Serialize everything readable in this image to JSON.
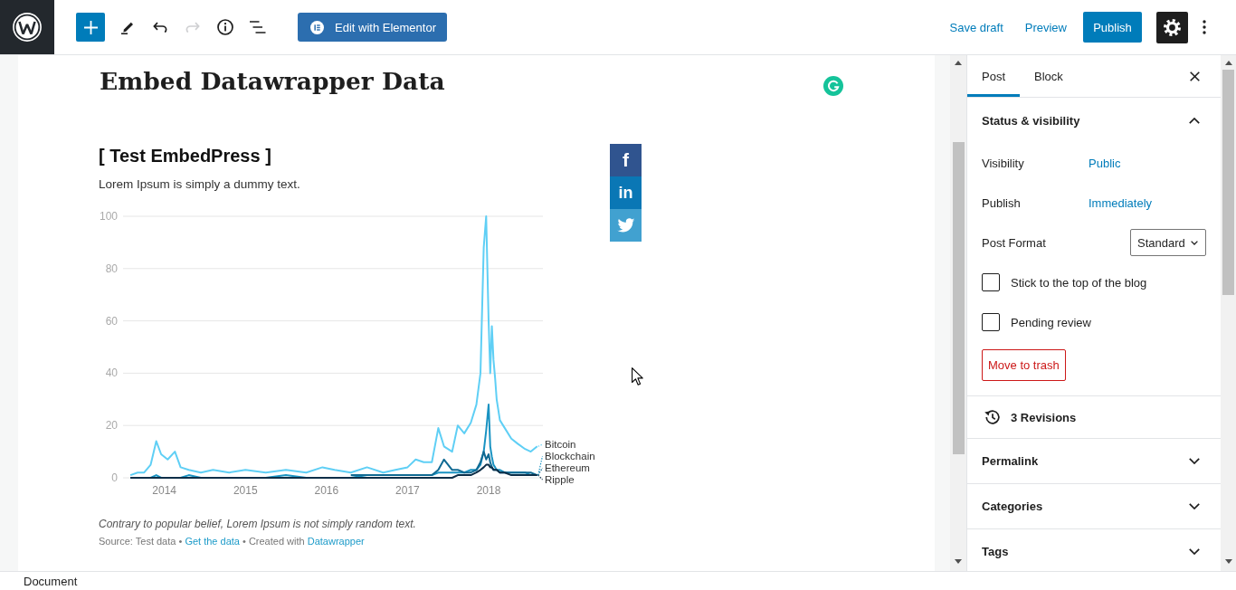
{
  "header": {
    "tools": [
      {
        "kind": "edit",
        "disabled": false
      },
      {
        "kind": "undo",
        "disabled": false
      },
      {
        "kind": "redo",
        "disabled": true
      },
      {
        "kind": "details",
        "disabled": false
      },
      {
        "kind": "outline",
        "disabled": false
      }
    ],
    "elementor_button": "Edit with Elementor",
    "save_draft": "Save draft",
    "preview": "Preview",
    "publish": "Publish",
    "settings_pressed": true
  },
  "editor": {
    "title": "Embed Datawrapper Data",
    "embed": {
      "title": "[ Test EmbedPress ]",
      "description": "Lorem Ipsum is simply a dummy text.",
      "chart_data": {
        "type": "line",
        "x": [
          2013.58,
          2013.67,
          2013.75,
          2013.83,
          2013.9,
          2013.96,
          2014.04,
          2014.13,
          2014.2,
          2014.3,
          2014.45,
          2014.6,
          2014.8,
          2015.0,
          2015.25,
          2015.5,
          2015.75,
          2015.95,
          2016.1,
          2016.3,
          2016.5,
          2016.7,
          2016.85,
          2017.0,
          2017.1,
          2017.2,
          2017.3,
          2017.38,
          2017.45,
          2017.55,
          2017.62,
          2017.7,
          2017.78,
          2017.85,
          2017.9,
          2017.94,
          2017.97,
          2018.0,
          2018.02,
          2018.04,
          2018.06,
          2018.08,
          2018.1,
          2018.14,
          2018.2,
          2018.28,
          2018.36,
          2018.45,
          2018.52,
          2018.6
        ],
        "series": [
          {
            "name": "Bitcoin",
            "color": "#5fcff5",
            "values": [
              1,
              2,
              2,
              5,
              14,
              9,
              7,
              10,
              4,
              3,
              2,
              3,
              2,
              3,
              2,
              3,
              2,
              4,
              3,
              2,
              4,
              2,
              3,
              4,
              7,
              6,
              6,
              19,
              12,
              10,
              20,
              17,
              21,
              28,
              40,
              88,
              100,
              60,
              40,
              58,
              45,
              38,
              30,
              22,
              19,
              15,
              13,
              11,
              10,
              12
            ]
          },
          {
            "name": "Blockchain",
            "color": "#1a93c2",
            "values": [
              0,
              0,
              0,
              0,
              1,
              0,
              0,
              0,
              0,
              1,
              0,
              0,
              0,
              0,
              0,
              1,
              0,
              0,
              0,
              0,
              1,
              1,
              1,
              1,
              1,
              1,
              1,
              2,
              2,
              2,
              2,
              2,
              3,
              3,
              5,
              10,
              18,
              28,
              12,
              8,
              5,
              4,
              3,
              3,
              2,
              2,
              2,
              2,
              1,
              1
            ]
          },
          {
            "name": "Ethereum",
            "color": "#106a93",
            "values": [
              null,
              null,
              null,
              null,
              null,
              null,
              null,
              null,
              null,
              null,
              null,
              null,
              null,
              null,
              null,
              null,
              null,
              null,
              null,
              1,
              1,
              1,
              1,
              1,
              1,
              1,
              1,
              3,
              7,
              3,
              3,
              2,
              2,
              3,
              6,
              10,
              7,
              9,
              6,
              4,
              3,
              3,
              3,
              2,
              2,
              2,
              2,
              2,
              2,
              1
            ]
          },
          {
            "name": "Ripple",
            "color": "#0c2e48",
            "values": [
              0,
              0,
              0,
              0,
              0,
              0,
              0,
              0,
              0,
              0,
              0,
              0,
              0,
              0,
              0,
              0,
              0,
              0,
              0,
              0,
              0,
              0,
              0,
              0,
              0,
              0,
              0,
              0,
              0,
              0,
              1,
              1,
              1,
              2,
              3,
              4,
              5,
              5,
              4,
              4,
              3,
              3,
              3,
              2,
              2,
              1,
              1,
              1,
              1,
              1
            ]
          }
        ],
        "xlim": [
          2013.49,
          2018.67
        ],
        "ylim": [
          0,
          100
        ],
        "xticks": [
          2014,
          2015,
          2016,
          2017,
          2018
        ],
        "yticks": [
          0,
          20,
          40,
          60,
          80,
          100
        ],
        "grid": true,
        "legend": "right"
      },
      "notes": "Contrary to popular belief, Lorem Ipsum is not simply random text.",
      "source": [
        {
          "kind": "text",
          "text": "Source: Test data • "
        },
        {
          "kind": "link",
          "text": "Get the data"
        },
        {
          "kind": "text",
          "text": " • Created with "
        },
        {
          "kind": "link",
          "text": "Datawrapper"
        }
      ],
      "share_buttons": [
        {
          "kind": "facebook",
          "glyph": "f"
        },
        {
          "kind": "linkedin",
          "glyph": "in"
        },
        {
          "kind": "twitter"
        }
      ]
    }
  },
  "sidebar": {
    "tabs": [
      {
        "label": "Post",
        "selected": true
      },
      {
        "label": "Block",
        "selected": false
      }
    ],
    "panels": [
      {
        "kind": "status",
        "title": "Status & visibility",
        "expanded": true,
        "fields": [
          {
            "label": "Visibility",
            "kind": "link",
            "value": "Public"
          },
          {
            "label": "Publish",
            "kind": "link",
            "value": "Immediately"
          },
          {
            "label": "Post Format",
            "kind": "select",
            "value": "Standard"
          }
        ],
        "checkboxes": [
          {
            "label": "Stick to the top of the blog",
            "checked": false
          },
          {
            "label": "Pending review",
            "checked": false
          }
        ],
        "trash_button": "Move to trash"
      },
      {
        "kind": "revisions",
        "title": "3 Revisions"
      },
      {
        "kind": "section",
        "title": "Permalink",
        "expanded": false
      },
      {
        "kind": "section",
        "title": "Categories",
        "expanded": false
      },
      {
        "kind": "section",
        "title": "Tags",
        "expanded": false
      }
    ]
  },
  "footer": {
    "breadcrumb": "Document"
  }
}
